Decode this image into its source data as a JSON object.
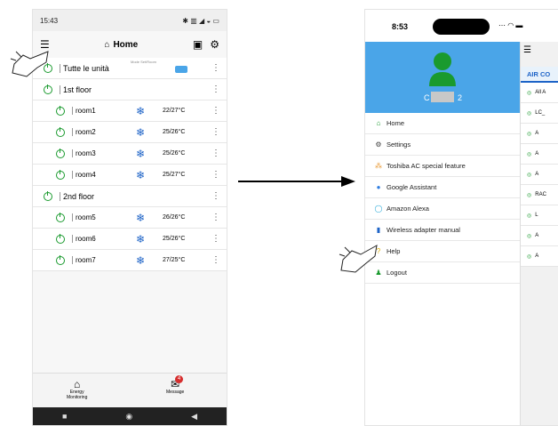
{
  "left": {
    "status_time": "15:43",
    "status_icons": "✱ ▥ ◢ ◒ ▭",
    "title": "Home",
    "all_units_label": "Tutte le unità",
    "mode_header": "Mode   Set/Room",
    "groups": [
      {
        "name": "1st floor",
        "rooms": [
          {
            "name": "room1",
            "temp": "22/27°C"
          },
          {
            "name": "room2",
            "temp": "25/26°C"
          },
          {
            "name": "room3",
            "temp": "25/26°C"
          },
          {
            "name": "room4",
            "temp": "25/27°C"
          }
        ]
      },
      {
        "name": "2nd floor",
        "rooms": [
          {
            "name": "room5",
            "temp": "26/26°C"
          },
          {
            "name": "room6",
            "temp": "25/26°C"
          },
          {
            "name": "room7",
            "temp": "27/25°C"
          }
        ]
      }
    ],
    "nav": {
      "energy": "Energy\nMonitoring",
      "message": "Message",
      "message_badge": "4"
    },
    "colors": {
      "accent_green": "#1a9a2e",
      "snow_blue": "#1d63c7"
    }
  },
  "right": {
    "status_time": "8:53",
    "status_icons": "⋯ ◠ ▬",
    "user_name_left": "C",
    "user_name_right": "2",
    "menu": [
      {
        "icon": "home-icon",
        "label": "Home"
      },
      {
        "icon": "gear-icon",
        "label": "Settings"
      },
      {
        "icon": "toshiba-icon",
        "label": "Toshiba AC special feature"
      },
      {
        "icon": "google-assistant-icon",
        "label": "Google Assistant"
      },
      {
        "icon": "alexa-icon",
        "label": "Amazon Alexa"
      },
      {
        "icon": "book-icon",
        "label": "Wireless adapter manual"
      },
      {
        "icon": "help-icon",
        "label": "Help"
      },
      {
        "icon": "user-icon",
        "label": "Logout"
      }
    ],
    "behind": {
      "tab": "AIR CO",
      "rows": [
        "All A",
        "LC_",
        "A",
        "A",
        "A",
        "RAC",
        "L",
        "A",
        "A"
      ]
    }
  }
}
